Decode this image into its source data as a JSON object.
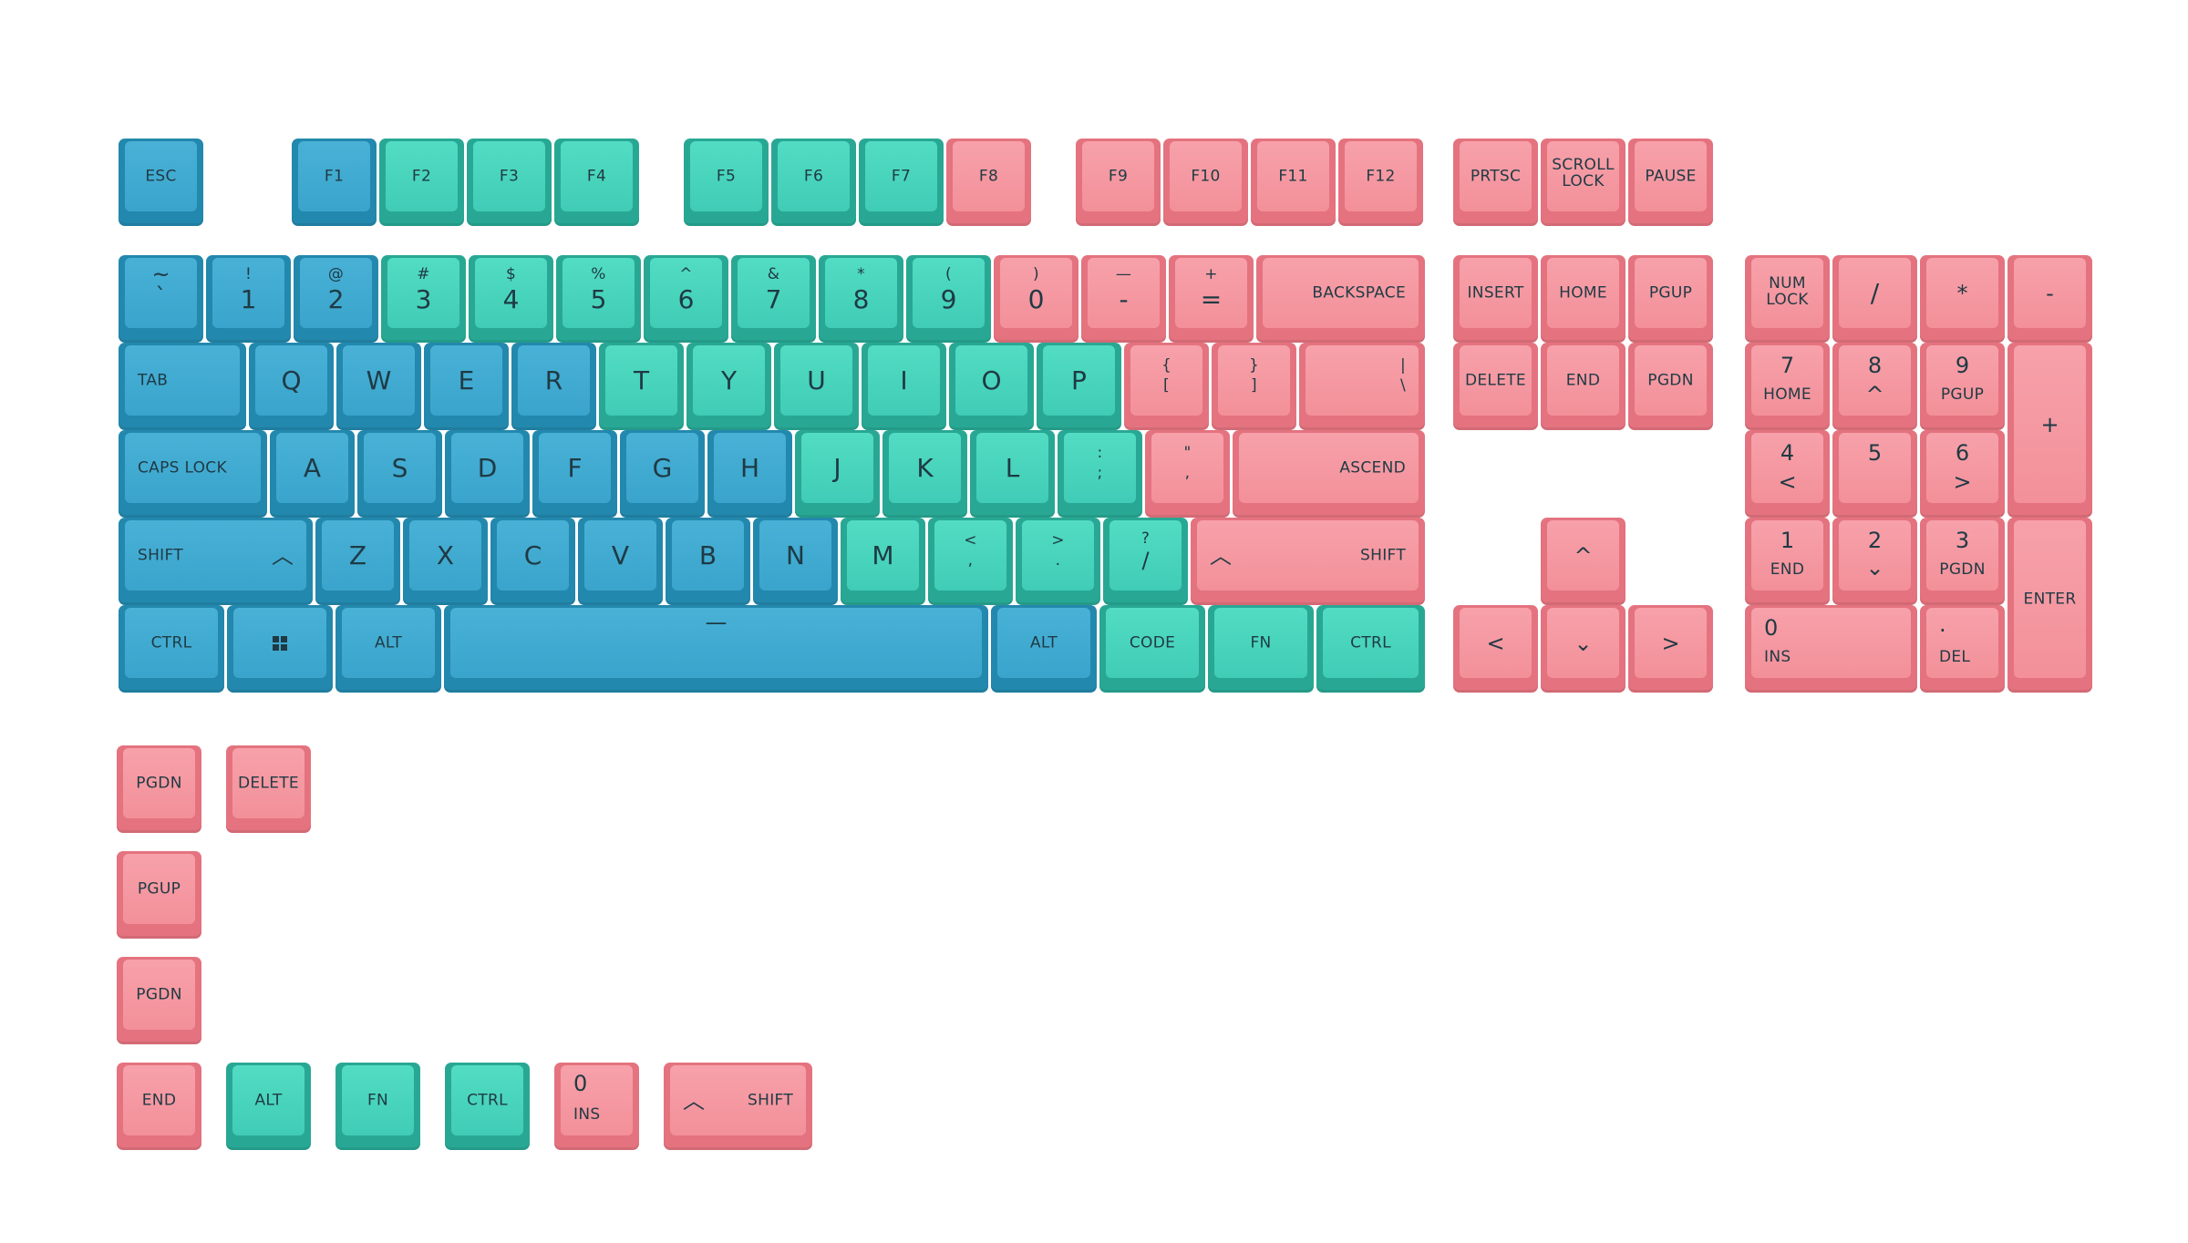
{
  "keys": {
    "esc": "ESC",
    "f1": "F1",
    "f2": "F2",
    "f3": "F3",
    "f4": "F4",
    "f5": "F5",
    "f6": "F6",
    "f7": "F7",
    "f8": "F8",
    "f9": "F9",
    "f10": "F10",
    "f11": "F11",
    "f12": "F12",
    "prtsc": "PRTSC",
    "scroll1": "SCROLL",
    "scroll2": "LOCK",
    "pause": "PAUSE",
    "tilde_s": "~",
    "tilde_u": "`",
    "n1_s": "!",
    "n1": "1",
    "n2_s": "@",
    "n2": "2",
    "n3_s": "#",
    "n3": "3",
    "n4_s": "$",
    "n4": "4",
    "n5_s": "%",
    "n5": "5",
    "n6_s": "^",
    "n6": "6",
    "n7_s": "&",
    "n7": "7",
    "n8_s": "*",
    "n8": "8",
    "n9_s": "(",
    "n9": "9",
    "n0_s": ")",
    "n0": "0",
    "minus_s": "—",
    "minus": "-",
    "eq_s": "+",
    "eq": "=",
    "backspace": "BACKSPACE",
    "insert": "INSERT",
    "home": "HOME",
    "pgup": "PGUP",
    "numlock1": "NUM",
    "numlock2": "LOCK",
    "slash_np": "/",
    "star_np": "*",
    "minus_np": "-",
    "tab": "TAB",
    "q": "Q",
    "w": "W",
    "e": "E",
    "r": "R",
    "t": "T",
    "y": "Y",
    "u": "U",
    "i": "I",
    "o": "O",
    "p": "P",
    "lbr_s": "{",
    "lbr": "[",
    "rbr_s": "}",
    "rbr": "]",
    "pipe_s": "|",
    "pipe": "\\",
    "delete": "DELETE",
    "end": "END",
    "pgdn": "PGDN",
    "np7": "7",
    "np7_s": "HOME",
    "np8": "8",
    "np8_s": "^",
    "np9": "9",
    "np9_s": "PGUP",
    "plus_np": "+",
    "caps": "CAPS LOCK",
    "a": "A",
    "s": "S",
    "d": "D",
    "f": "F",
    "g": "G",
    "h": "H",
    "j": "J",
    "k": "K",
    "l": "L",
    "semi_s": ":",
    "semi": ";",
    "quote_s": "\"",
    "quote": ",",
    "ascend": "ASCEND",
    "np4": "4",
    "np4_s": "<",
    "np5": "5",
    "np6": "6",
    "np6_s": ">",
    "shift": "SHIFT",
    "shift_arrow": "︿",
    "z": "Z",
    "x": "X",
    "c": "C",
    "v": "V",
    "b": "B",
    "n": "N",
    "m": "M",
    "comma_s": "<",
    "comma": ",",
    "period_s": ">",
    "period": ".",
    "slash_s": "?",
    "slash": "/",
    "up": "^",
    "np1": "1",
    "np1_s": "END",
    "np2": "2",
    "np2_s": "⌄",
    "np3": "3",
    "np3_s": "PGDN",
    "enter": "ENTER",
    "ctrl": "CTRL",
    "win": "▪▪",
    "alt": "ALT",
    "space": "—",
    "code": "CODE",
    "fn": "FN",
    "left": "<",
    "down": "⌄",
    "right": ">",
    "np0": "0",
    "np0_s": "INS",
    "npdot": ".",
    "npdot_s": "DEL"
  },
  "colors": {
    "blue": "#3aa4cc",
    "teal": "#40ccb6",
    "pink": "#f39099"
  }
}
